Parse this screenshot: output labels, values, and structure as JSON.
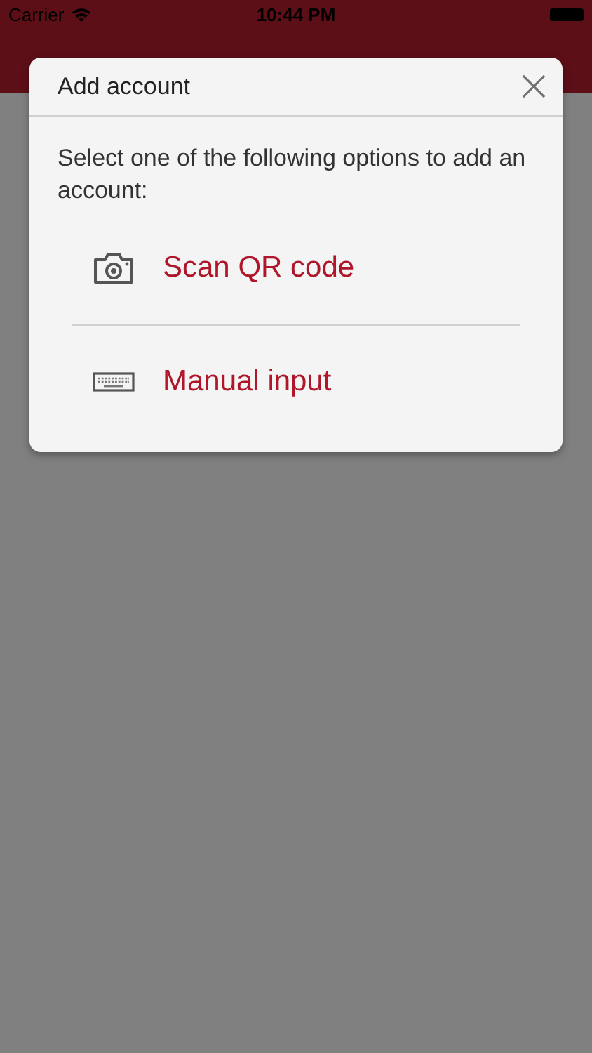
{
  "status_bar": {
    "carrier": "Carrier",
    "time": "10:44 PM"
  },
  "dialog": {
    "title": "Add account",
    "message": "Select one of the following options to add an account:",
    "options": [
      {
        "kind": "camera",
        "label": "Scan QR code"
      },
      {
        "kind": "keyboard",
        "label": "Manual input"
      }
    ]
  }
}
